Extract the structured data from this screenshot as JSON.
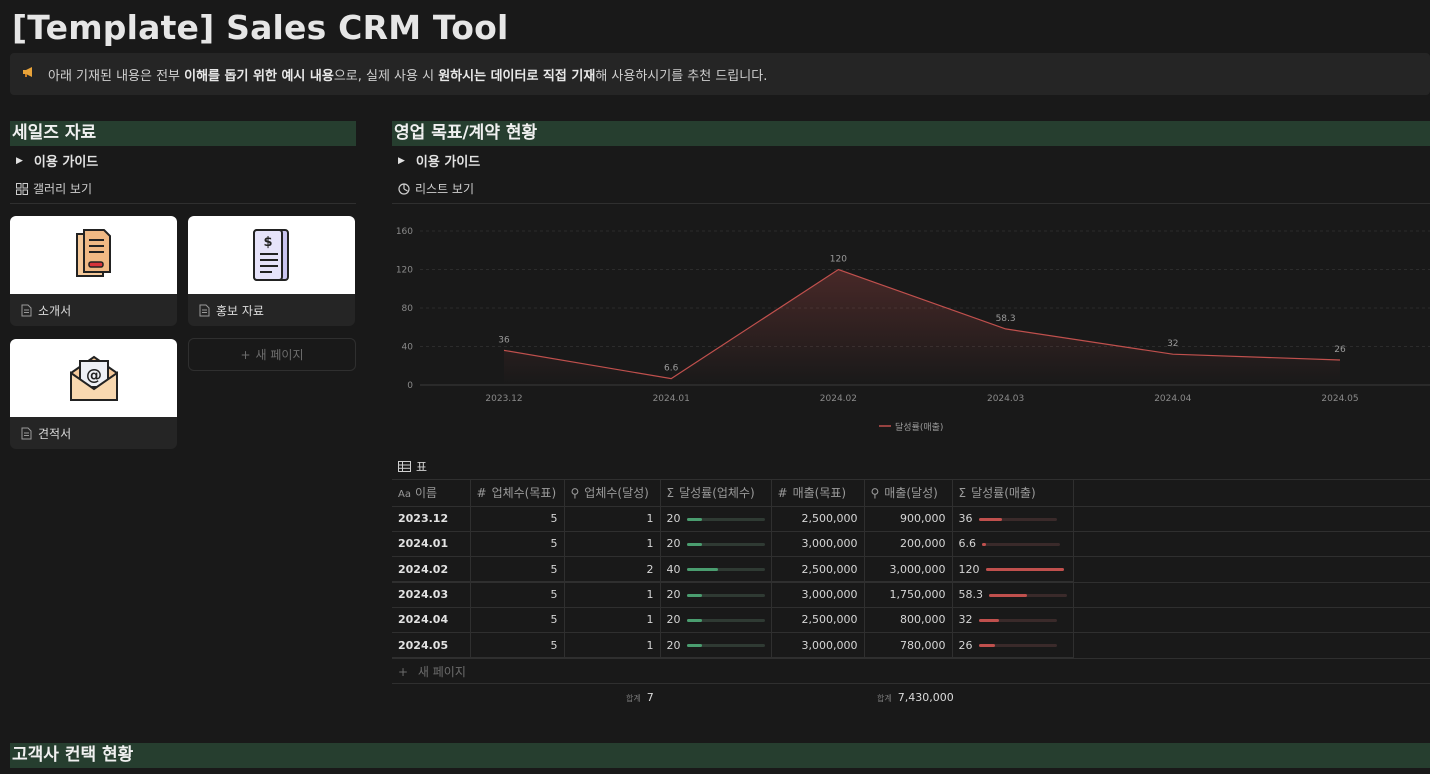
{
  "page": {
    "title": "[Template] Sales CRM Tool"
  },
  "callout": {
    "icon": "megaphone-icon",
    "text_1": "아래 기재된 내용은 전부 ",
    "bold_1": "이해를 돕기 위한 예시 내용",
    "text_2": "으로, 실제 사용 시 ",
    "bold_2": "원하시는 데이터로 직접 기재",
    "text_3": "해 사용하시기를 추천 드립니다."
  },
  "sales_materials": {
    "heading": "세일즈 자료",
    "guide_toggle": "이용 가이드",
    "view_label": "갤러리 보기",
    "cards": [
      {
        "title": "소개서",
        "icon": "document-folder-icon"
      },
      {
        "title": "홍보 자료",
        "icon": "invoice-icon"
      },
      {
        "title": "견적서",
        "icon": "email-envelope-icon"
      }
    ],
    "new_page": "새 페이지"
  },
  "sales_goals": {
    "heading": "영업 목표/계약 현황",
    "guide_toggle": "이용 가이드",
    "view_label": "리스트 보기",
    "table_view_label": "표",
    "columns": [
      "이름",
      "업체수(목표)",
      "업체수(달성)",
      "달성률(업체수)",
      "매출(목표)",
      "매출(달성)",
      "달성률(매출)"
    ],
    "column_icons": [
      "text-icon",
      "number-icon",
      "lookup-icon",
      "formula-icon",
      "number-icon",
      "lookup-icon",
      "formula-icon"
    ],
    "rows": [
      {
        "name": "2023.12",
        "target_count": "5",
        "achieved_count": "1",
        "count_rate": "20",
        "count_rate_value": 20,
        "target_sales": "2,500,000",
        "achieved_sales": "900,000",
        "sales_rate": "36",
        "sales_rate_value": 36
      },
      {
        "name": "2024.01",
        "target_count": "5",
        "achieved_count": "1",
        "count_rate": "20",
        "count_rate_value": 20,
        "target_sales": "3,000,000",
        "achieved_sales": "200,000",
        "sales_rate": "6.6",
        "sales_rate_value": 6.6
      },
      {
        "name": "2024.02",
        "target_count": "5",
        "achieved_count": "2",
        "count_rate": "40",
        "count_rate_value": 40,
        "target_sales": "2,500,000",
        "achieved_sales": "3,000,000",
        "sales_rate": "120",
        "sales_rate_value": 120
      },
      {
        "name": "2024.03",
        "target_count": "5",
        "achieved_count": "1",
        "count_rate": "20",
        "count_rate_value": 20,
        "target_sales": "3,000,000",
        "achieved_sales": "1,750,000",
        "sales_rate": "58.3",
        "sales_rate_value": 58.3
      },
      {
        "name": "2024.04",
        "target_count": "5",
        "achieved_count": "1",
        "count_rate": "20",
        "count_rate_value": 20,
        "target_sales": "2,500,000",
        "achieved_sales": "800,000",
        "sales_rate": "32",
        "sales_rate_value": 32
      },
      {
        "name": "2024.05",
        "target_count": "5",
        "achieved_count": "1",
        "count_rate": "20",
        "count_rate_value": 20,
        "target_sales": "3,000,000",
        "achieved_sales": "780,000",
        "sales_rate": "26",
        "sales_rate_value": 26
      }
    ],
    "new_row": "새 페이지",
    "sum_label": "합계",
    "sum_count": "7",
    "sum_sales": "7,430,000",
    "colors": {
      "count_bar": "#4a9d6f",
      "sales_bar": "#c0504d",
      "bar_track": "#2f3a33"
    }
  },
  "chart_data": {
    "type": "line",
    "x": [
      "2023.12",
      "2024.01",
      "2024.02",
      "2024.03",
      "2024.04",
      "2024.05"
    ],
    "series": [
      {
        "name": "달성률(매출)",
        "values": [
          36,
          6.6,
          120,
          58.3,
          32,
          26
        ],
        "color": "#c0504d"
      }
    ],
    "y_ticks": [
      0,
      40,
      80,
      120,
      160
    ],
    "ylim": [
      0,
      160
    ],
    "grid": true,
    "legend": "bottom-center",
    "data_labels": [
      "36",
      "6.6",
      "120",
      "58.3",
      "32",
      "26"
    ]
  },
  "customer_contacts": {
    "heading": "고객사 컨택 현황"
  }
}
